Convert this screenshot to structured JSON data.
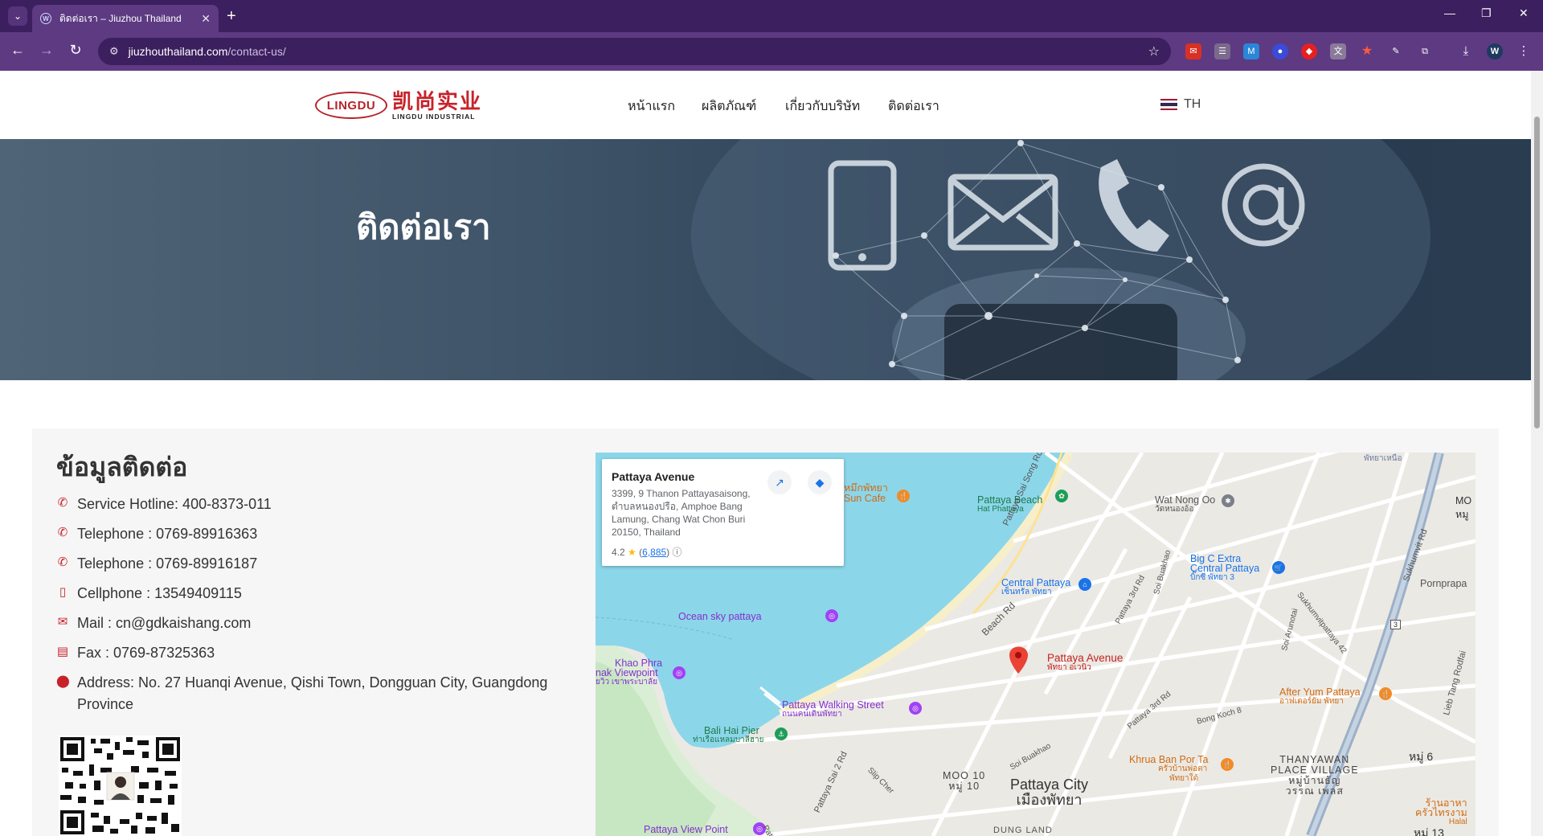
{
  "browser": {
    "tab_title": "ติดต่อเรา – Jiuzhou Thailand",
    "url_host": "jiuzhouthailand.com",
    "url_path": "/contact-us/"
  },
  "site": {
    "logo_mark": "LINGDU",
    "logo_cn": "凯尚实业",
    "logo_en": "LINGDU INDUSTRIAL",
    "menu": [
      "หน้าแรก",
      "ผลิตภัณฑ์",
      "เกี่ยวกับบริษัท",
      "ติดต่อเรา"
    ],
    "lang": "TH"
  },
  "hero": {
    "title": "ติดต่อเรา"
  },
  "contact": {
    "title": "ข้อมูลติดต่อ",
    "items": [
      {
        "icon": "phone-icon",
        "text": "Service Hotline: 400-8373-011"
      },
      {
        "icon": "phone-icon",
        "text": "Telephone : 0769-89916363"
      },
      {
        "icon": "phone-icon",
        "text": "Telephone : 0769-89916187"
      },
      {
        "icon": "mobile-icon",
        "text": "Cellphone : 13549409115"
      },
      {
        "icon": "mail-icon",
        "text": "Mail : cn@gdkaishang.com"
      },
      {
        "icon": "fax-icon",
        "text": "Fax : 0769-87325363"
      },
      {
        "icon": "location-pin-icon",
        "text": "Address: No. 27 Huanqi Avenue, Qishi Town, Dongguan City, Guangdong Province"
      }
    ]
  },
  "map": {
    "card": {
      "name": "Pattaya Avenue",
      "address": "3399, 9 Thanon Pattayasaisong, ตำบลหนองปรือ, Amphoe Bang Lamung, Chang Wat Chon Buri 20150, Thailand",
      "rating": "4.2",
      "reviews": "6,885"
    },
    "labels": {
      "sun_cafe_1": "หมึกพัทยา",
      "sun_cafe_2": "Sun Cafe",
      "pattaya_beach_1": "Pattaya Beach",
      "pattaya_beach_2": "Hat Phattaya",
      "wat_nong_oo_1": "Wat Nong Oo",
      "wat_nong_oo_2": "วัดหนองอ้อ",
      "mo": "MO",
      "mo_th": "หมู",
      "phatthaya_nuea": "พัทยาเหนือ",
      "big_c_1": "Big C Extra",
      "big_c_2": "Central Pattaya",
      "big_c_3": "บิ๊กซี พัทยา 3",
      "central_1": "Central Pattaya",
      "central_2": "เซ็นทรัล พัทยา",
      "pornprapa": "Pornprapa",
      "ocean_sky": "Ocean sky pattaya",
      "khao_phra_1": "Khao Phra",
      "khao_phra_2": "nak Viewpoint",
      "khao_phra_3": "ยวิว เขาพระบาลัย",
      "beach_rd": "Beach Rd",
      "pattaya_avenue": "Pattaya Avenue",
      "pattaya_avenue_th": "พัทยา อเวนิว",
      "walking_1": "Pattaya Walking Street",
      "walking_2": "ถนนคนเดินพัทยา",
      "after_yum_1": "After Yum Pattaya",
      "after_yum_2": "อาฟเตอร์ยัม พัทยา",
      "bali_hai_1": "Bali Hai Pier",
      "bali_hai_2": "ท่าเรือแหลมบาลีฮาย",
      "khrua_1": "Khrua Ban Por Ta",
      "khrua_2": "ครัวบ้านพ่อตา",
      "khrua_3": "พัทยาใต้",
      "thanyawan_1": "THANYAWAN",
      "thanyawan_2": "PLACE VILLAGE",
      "thanyawan_3": "หมู่บ้านธัญ",
      "thanyawan_4": "วรรณ เพลส",
      "moo10_1": "MOO 10",
      "moo10_2": "หมู่ 10",
      "city_1": "Pattaya City",
      "city_2": "เมืองพัทยา",
      "moo6": "หมู่ 6",
      "moo13": "หมู่ 13",
      "halal_1": "ร้านอาหา",
      "halal_2": "ครัวไทรงาม",
      "halal_3": "Halal",
      "view_point": "Pattaya View Point",
      "sai_song": "Pattaya Sai Song Rd",
      "sai_2": "Pattaya Sai 2 Rd",
      "third_rd": "Pattaya 3rd Rd",
      "third_rd_2": "Pattaya 3rd Rd",
      "third_rd_3": "Pattaya 3rd Rc",
      "sukhumvit": "Sukhumvit Rd",
      "lieb_tang": "Lieb Tang Rodfai",
      "soi_arunotai": "Soi Arunotai",
      "sukhumvit_42": "Sukhumvitpattaya 42",
      "soi_buakhao": "Soi Buakhao",
      "soi_buakhao_2": "Soi Buakhao",
      "bong_koch": "Bong Koch 8",
      "slip_cher": "Slip Cher",
      "route3": "3",
      "dung_land": "DUNG LAND"
    }
  }
}
